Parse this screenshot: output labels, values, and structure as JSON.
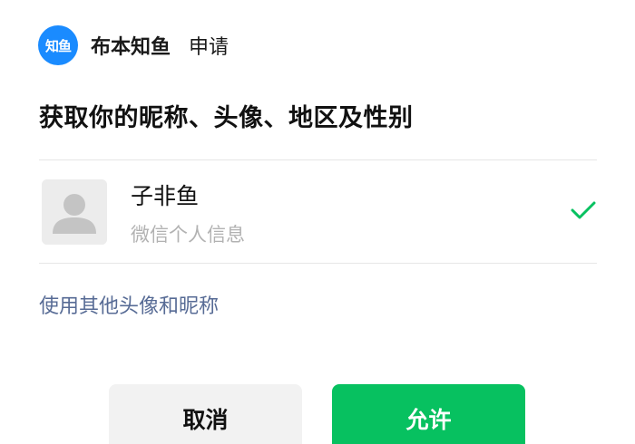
{
  "app": {
    "name": "布本知鱼",
    "action": "申请",
    "logo_text": "知鱼",
    "logo_color": "#1a8bff"
  },
  "request": {
    "title": "获取你的昵称、头像、地区及性别"
  },
  "profile_option": {
    "nickname": "子非鱼",
    "source": "微信个人信息",
    "avatar_icon": "default-avatar-icon",
    "selected": true,
    "check_icon": "checkmark-icon",
    "check_color": "#07c160"
  },
  "alt_link": {
    "label": "使用其他头像和昵称",
    "color": "#576b95"
  },
  "buttons": {
    "cancel_label": "取消",
    "allow_label": "允许",
    "allow_color": "#07c160"
  }
}
